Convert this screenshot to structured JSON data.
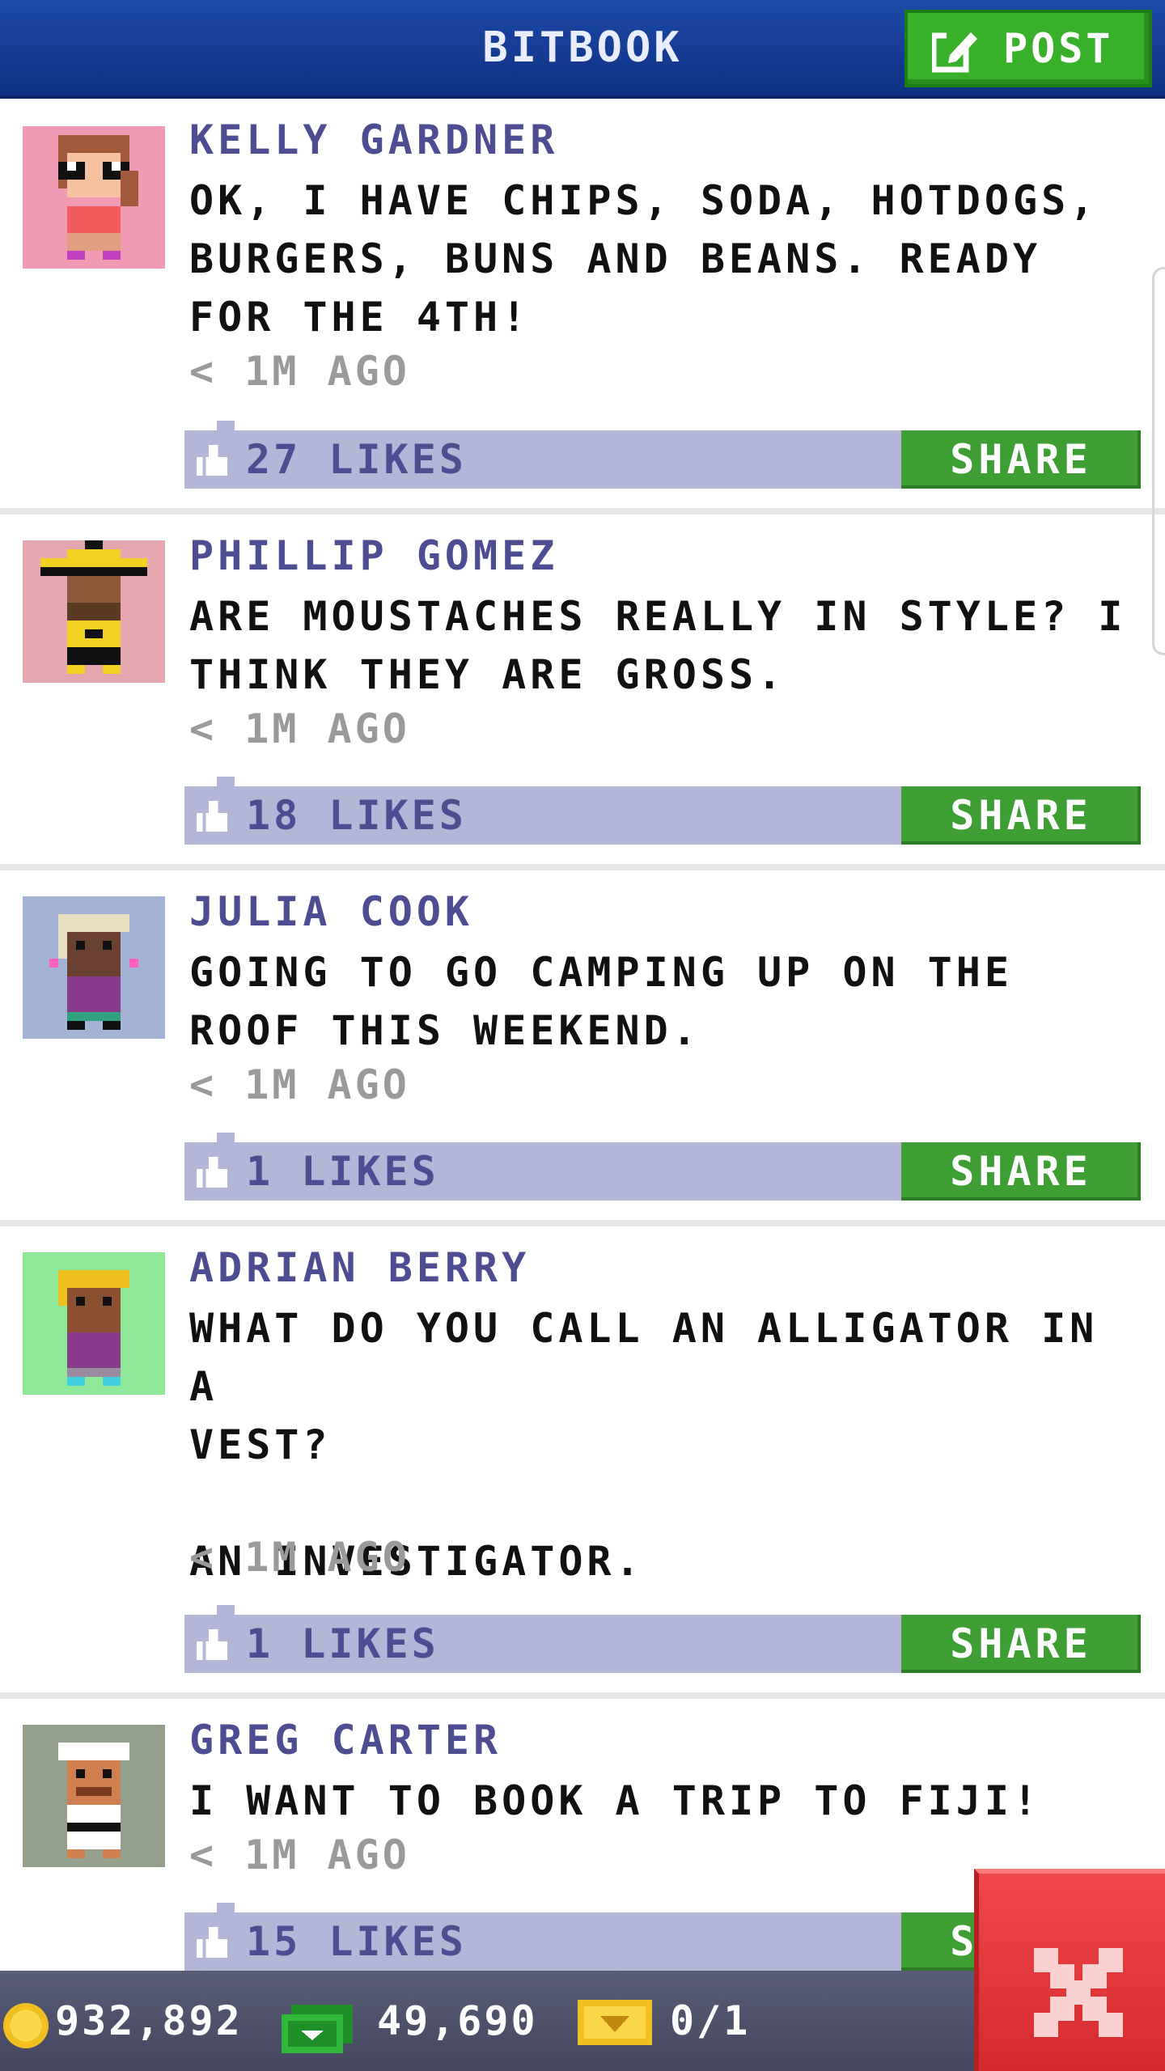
{
  "header": {
    "title": "BITBOOK",
    "post_label": "POST",
    "bg_color": "#1d49a8",
    "post_color": "#38b02a"
  },
  "posts": [
    {
      "author": "KELLY GARDNER",
      "text": "OK, I HAVE CHIPS, SODA, HOTDOGS,\nBURGERS, BUNS AND BEANS. READY\nFOR THE 4TH!",
      "time": "< 1M AGO",
      "likes": "27 LIKES",
      "share_label": "SHARE",
      "avatar_icon": "girl-with-glasses-avatar",
      "avatar_bg": "#f09ab4"
    },
    {
      "author": "PHILLIP GOMEZ",
      "text": "ARE MOUSTACHES REALLY IN STYLE? I\nTHINK THEY ARE GROSS.",
      "time": "< 1M AGO",
      "likes": "18 LIKES",
      "share_label": "SHARE",
      "avatar_icon": "man-with-hat-avatar",
      "avatar_bg": "#e6a8b0"
    },
    {
      "author": "JULIA COOK",
      "text": "GOING TO GO CAMPING UP ON THE\nROOF THIS WEEKEND.",
      "time": "< 1M AGO",
      "likes": "1 LIKES",
      "share_label": "SHARE",
      "avatar_icon": "woman-avatar",
      "avatar_bg": "#a4b2d6"
    },
    {
      "author": "ADRIAN BERRY",
      "text": "WHAT DO YOU CALL AN ALLIGATOR IN A\nVEST?\n\nAN INVESTIGATOR.",
      "time": "< 1M AGO",
      "likes": "1 LIKES",
      "share_label": "SHARE",
      "avatar_icon": "blonde-avatar",
      "avatar_bg": "#8ee898"
    },
    {
      "author": "GREG CARTER",
      "text": "I WANT TO BOOK A TRIP TO FIJI!",
      "time": "< 1M AGO",
      "likes": "15 LIKES",
      "share_label": "SHARE",
      "avatar_icon": "karate-man-avatar",
      "avatar_bg": "#94a08c"
    }
  ],
  "bottombar": {
    "coins": "932,892",
    "cash": "49,690",
    "tickets": "0/1"
  }
}
